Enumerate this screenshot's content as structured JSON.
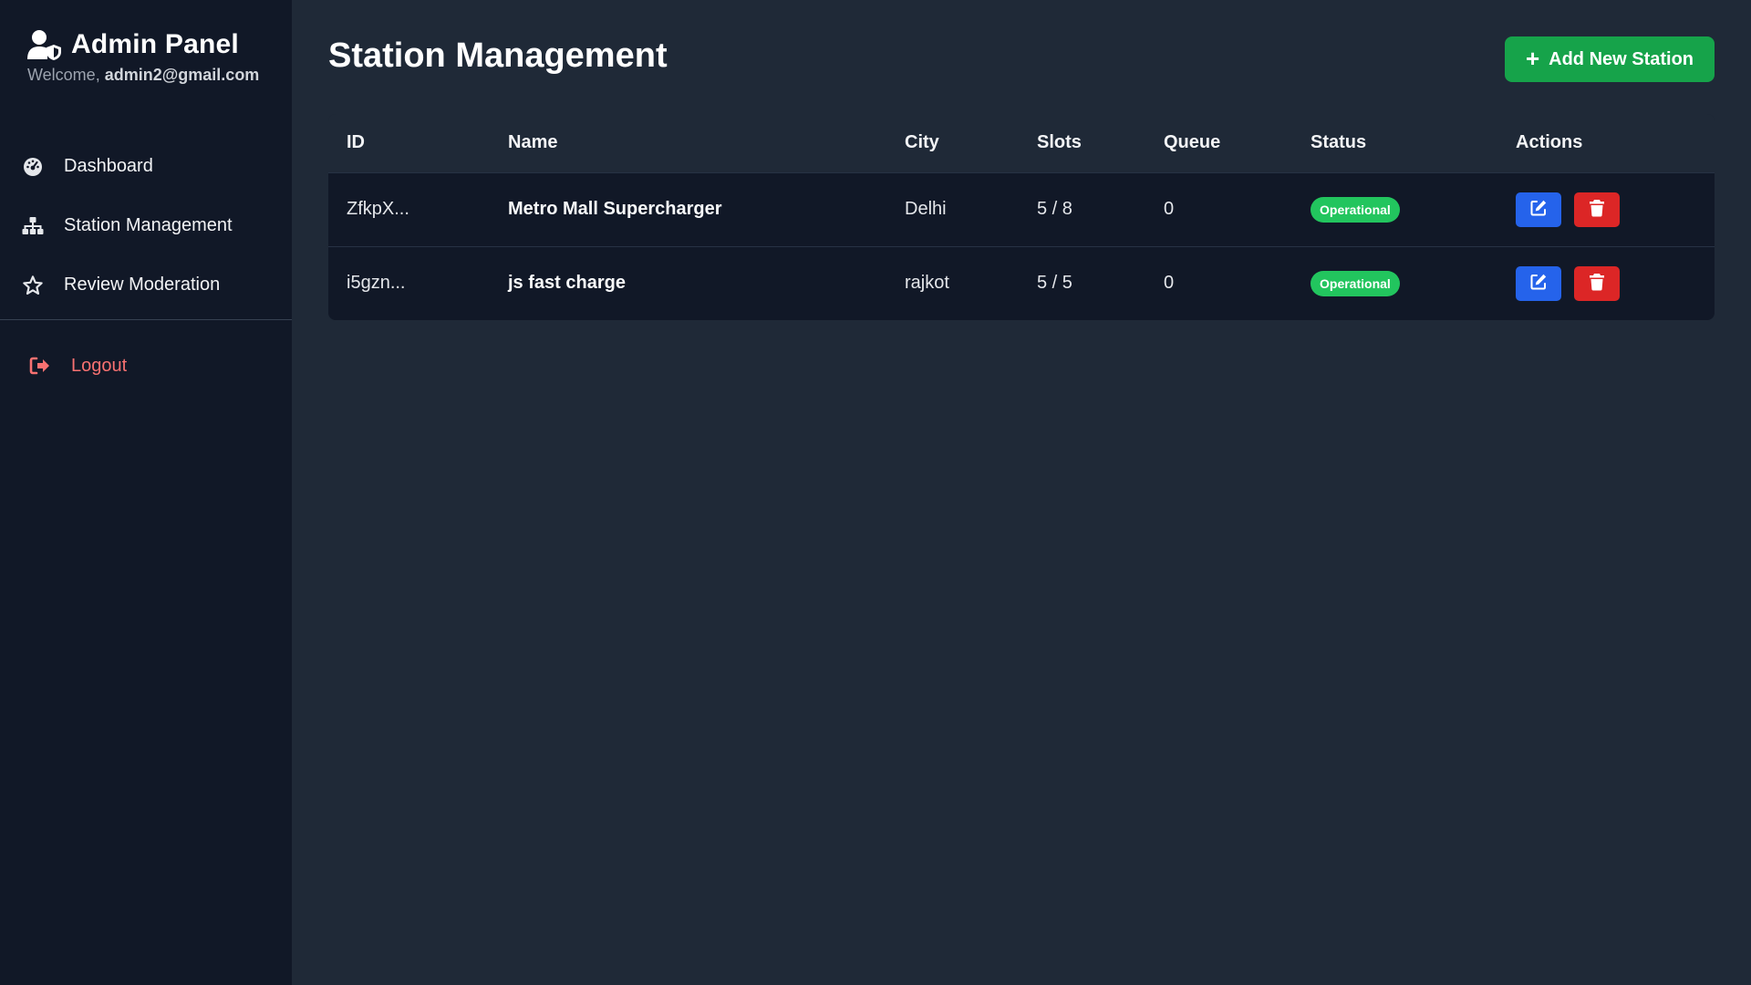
{
  "sidebar": {
    "title": "Admin Panel",
    "welcome_prefix": "Welcome,",
    "user_email": "admin2@gmail.com",
    "items": [
      {
        "label": "Dashboard",
        "icon": "dashboard-gauge-icon"
      },
      {
        "label": "Station Management",
        "icon": "sitemap-icon"
      },
      {
        "label": "Review Moderation",
        "icon": "star-icon"
      }
    ],
    "logout_label": "Logout"
  },
  "main": {
    "title": "Station Management",
    "add_button_label": "Add New Station",
    "table": {
      "headers": [
        "ID",
        "Name",
        "City",
        "Slots",
        "Queue",
        "Status",
        "Actions"
      ],
      "rows": [
        {
          "id": "ZfkpX...",
          "name": "Metro Mall Supercharger",
          "city": "Delhi",
          "slots": "5 / 8",
          "queue": "0",
          "status": "Operational"
        },
        {
          "id": "i5gzn...",
          "name": "js fast charge",
          "city": "rajkot",
          "slots": "5 / 5",
          "queue": "0",
          "status": "Operational"
        }
      ]
    }
  },
  "colors": {
    "sidebar_bg": "#111827",
    "main_bg": "#1f2937",
    "accent_green": "#16a34a",
    "badge_green": "#22c55e",
    "edit_blue": "#2563eb",
    "delete_red": "#dc2626",
    "logout_red": "#f87171"
  }
}
